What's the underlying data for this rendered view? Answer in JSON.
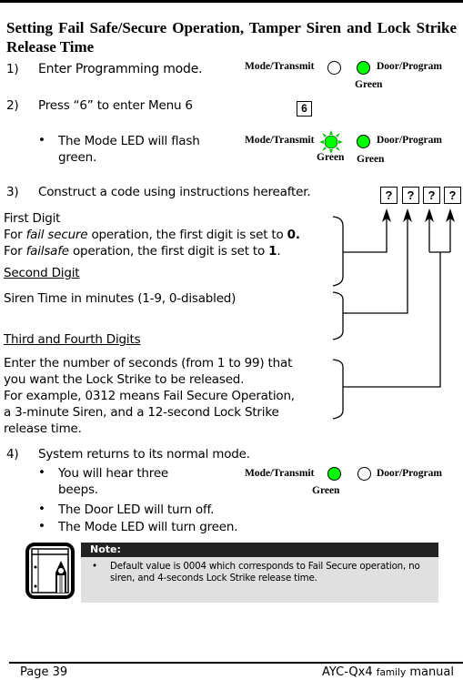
{
  "title": "Setting Fail Safe/Secure Operation, Tamper Siren and Lock Strike Release Time",
  "steps": [
    {
      "num": "1)",
      "text": "Enter Programming mode."
    },
    {
      "num": "2)",
      "text": "Press “6” to enter Menu 6",
      "bullets": [
        "The Mode LED will flash green."
      ]
    },
    {
      "num": "3)",
      "text": "Construct a code using instructions hereafter."
    },
    {
      "num": "4)",
      "text": "System returns to its normal mode.",
      "bullets": [
        "You will hear three beeps.",
        "The Door LED will turn off.",
        "The Mode LED will turn green."
      ]
    }
  ],
  "led_labels": {
    "mode": "Mode/Transmit",
    "door": "Door/Program",
    "green": "Green"
  },
  "led_states": {
    "step1": {
      "mode": "off",
      "door": "green"
    },
    "step2": {
      "mode": "flashing green",
      "door": "green"
    },
    "step4": {
      "mode": "green",
      "door": "off"
    }
  },
  "led_colors": {
    "green": "#00ff00"
  },
  "key": "6",
  "code_boxes": [
    "?",
    "?",
    "?",
    "?"
  ],
  "digits": {
    "first": {
      "heading": "First Digit",
      "line1_prefix": "For ",
      "line1_italic": "fail secure",
      "line1_mid": " operation, the first digit is set to ",
      "line1_bold": "0.",
      "line2_prefix": "For ",
      "line2_italic": "failsafe",
      "line2_mid": " operation, the first digit is set to ",
      "line2_bold": "1",
      "line2_end": "."
    },
    "second": {
      "heading": "Second Digit",
      "text": "Siren Time in minutes (1-9, 0-disabled)"
    },
    "third_fourth": {
      "heading": "Third and Fourth Digits",
      "lines": [
        "Enter the number of seconds (from 1 to 99) that",
        "you want the Lock Strike to be released.",
        "For example, 0312 means Fail Secure Operation,",
        "a 3-minute Siren, and a 12-second Lock Strike",
        "release time."
      ]
    }
  },
  "note": {
    "heading": "Note:",
    "icon": "notebook-pencil-icon",
    "text": "Default value is 0004 which corresponds to Fail Secure operation, no siren, and 4-seconds Lock Strike release time."
  },
  "footer": {
    "page": "Page 39",
    "manual_main": "AYC-Qx4",
    "manual_small": "family",
    "manual_end": "manual"
  }
}
